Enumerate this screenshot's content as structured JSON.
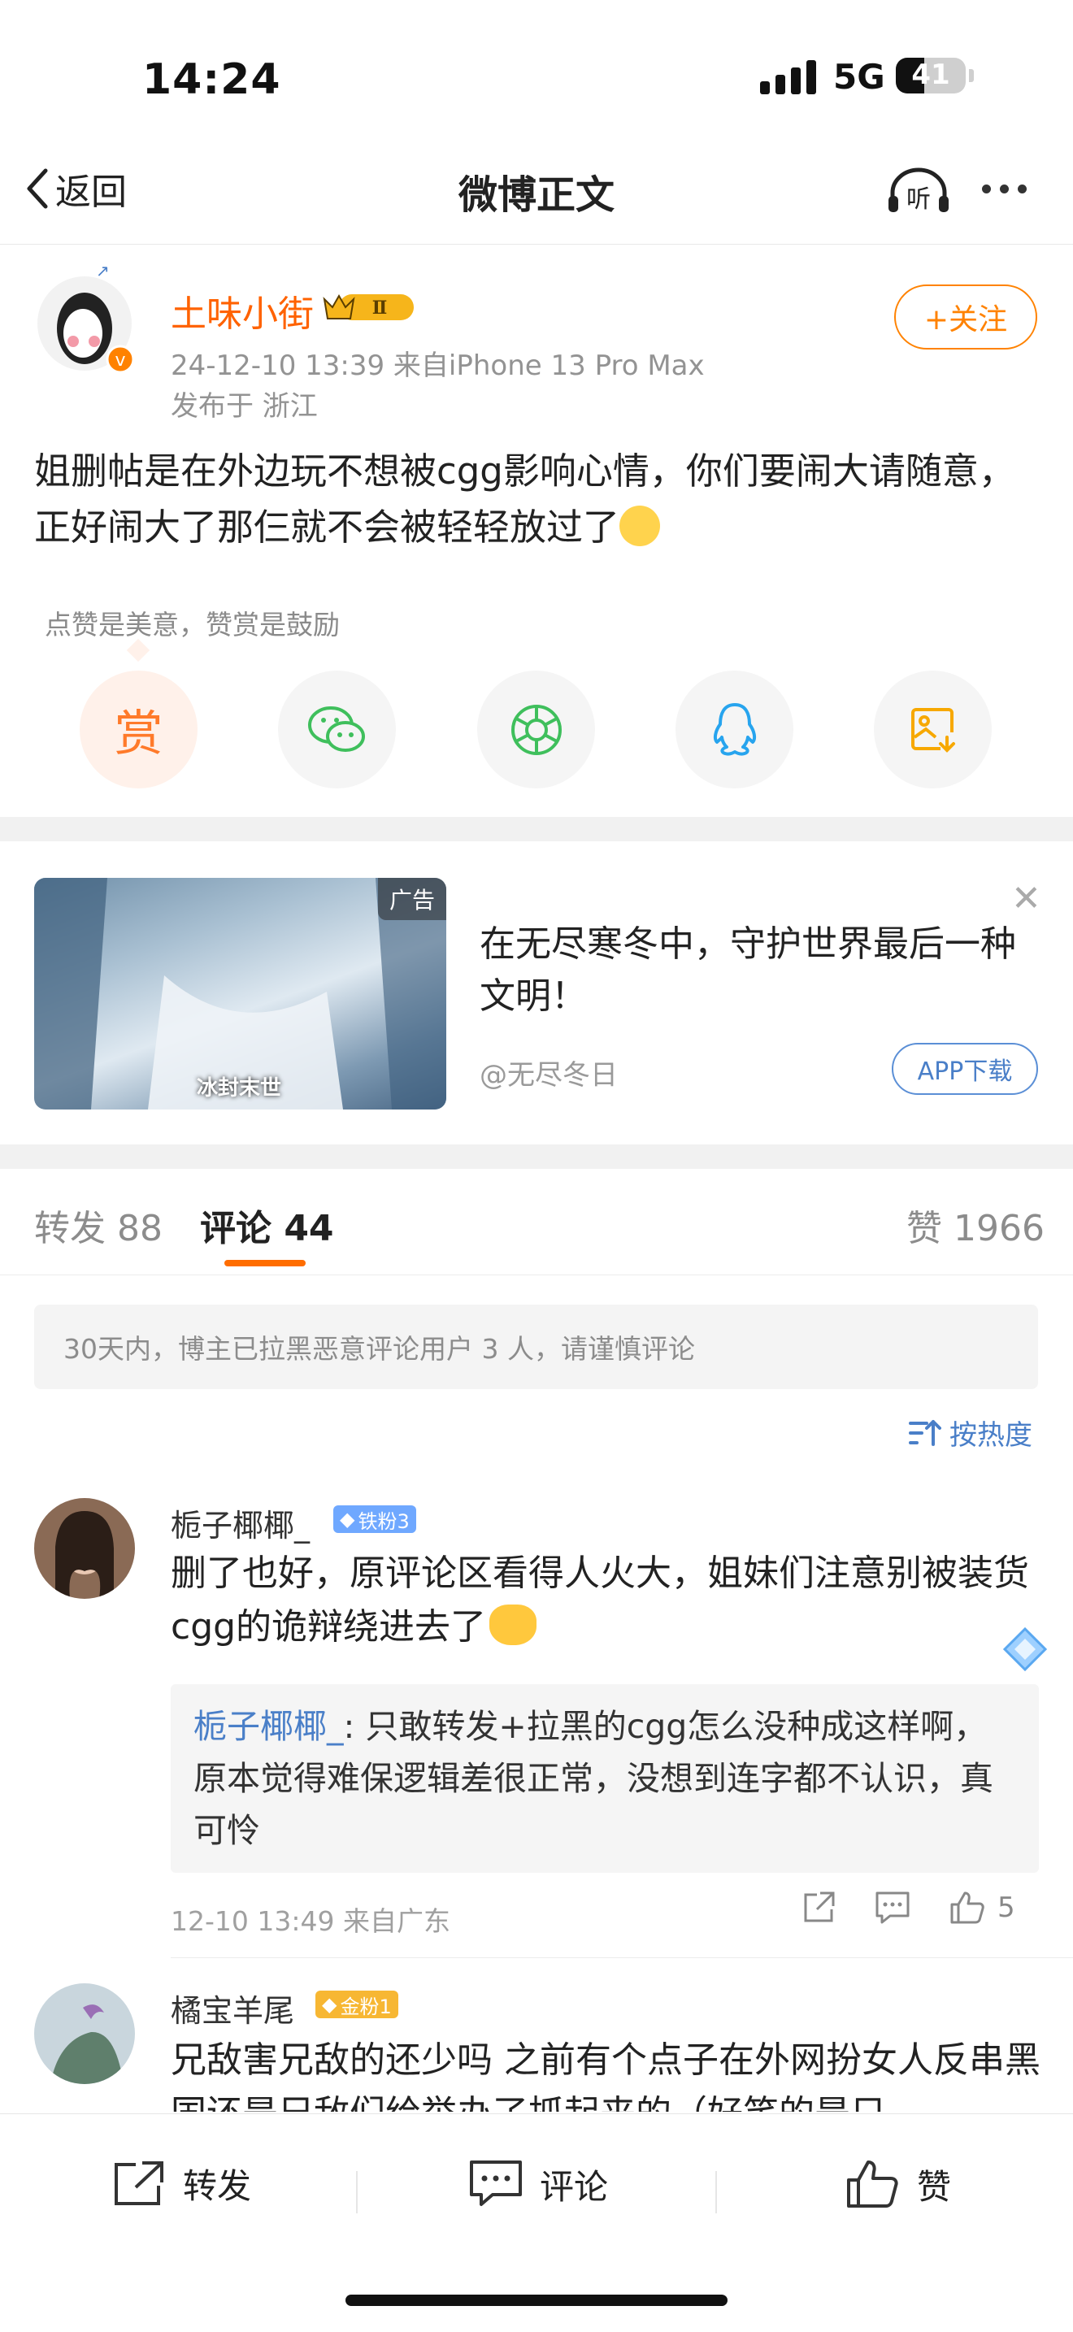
{
  "status_bar": {
    "time": "14:24",
    "network": "5G",
    "battery": "41",
    "battery_level": 0.41
  },
  "nav": {
    "back_label": "返回",
    "title": "微博正文",
    "listen_label": "听"
  },
  "post": {
    "author": "土味小街",
    "rank_badge": "Ⅱ",
    "meta": "24-12-10 13:39  来自iPhone 13 Pro Max",
    "location": "发布于 浙江",
    "follow_label": "+关注",
    "content": "姐删帖是在外边玩不想被cgg影响心情，你们要闹大请随意，正好闹大了那仨就不会被轻轻放过了"
  },
  "reward": {
    "tip": "点赞是美意，赞赏是鼓励",
    "reward_label": "赏"
  },
  "share_icons": [
    "reward-icon",
    "wechat-icon",
    "moments-icon",
    "qq-icon",
    "save-image-icon"
  ],
  "ad": {
    "tag": "广告",
    "image_caption": "冰封末世",
    "title": "在无尽寒冬中，守护世界最后一种文明！",
    "source": "@无尽冬日",
    "button": "APP下载"
  },
  "tabs": {
    "repost": "转发 88",
    "comment": "评论 44",
    "like": "赞 1966"
  },
  "notice": "30天内，博主已拉黑恶意评论用户 3 人，请谨慎评论",
  "sort_label": "按热度",
  "comments": [
    {
      "name": "栀子椰椰_",
      "badge": "铁粉3",
      "text": "删了也好，原评论区看得人火大，姐妹们注意别被装货cgg的诡辩绕进去了",
      "reply_name": "栀子椰椰_",
      "reply_text": ": 只敢转发+拉黑的cgg怎么没种成这样啊，原本觉得难保逻辑差很正常，没想到连字都不认识，真可怜",
      "meta": "12-10 13:49  来自广东",
      "likes": "5"
    },
    {
      "name": "橘宝羊尾",
      "badge": "金粉1",
      "text": "兄敌害兄敌的还少吗 之前有个点子在外网扮女人反串黑国还是兄敌们给举办了抓起来的（好笑的是只"
    }
  ],
  "bottom_bar": {
    "repost": "转发",
    "comment": "评论",
    "like": "赞"
  },
  "colors": {
    "accent": "#ff8200",
    "link": "#4a7fc8",
    "author": "#ff6200"
  }
}
